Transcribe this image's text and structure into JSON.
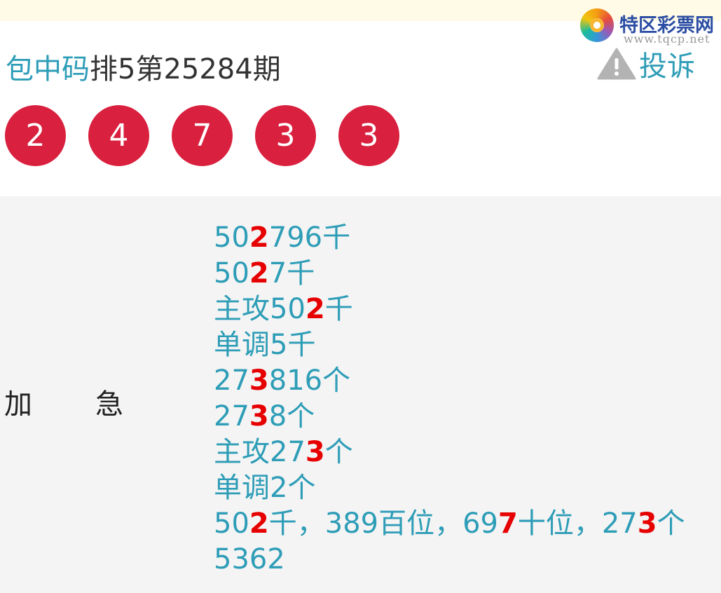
{
  "logo": {
    "name": "特区彩票网",
    "url": "www.tqcp.net"
  },
  "header": {
    "brand": "包中码",
    "title": "排5第25284期"
  },
  "complain": {
    "label": "投诉"
  },
  "numbers": [
    "2",
    "4",
    "7",
    "3",
    "3"
  ],
  "panel": {
    "tag_left": "加",
    "tag_right": "急",
    "lines": [
      [
        "50",
        "2",
        "796千"
      ],
      [
        "50",
        "2",
        "7千"
      ],
      [
        "主攻50",
        "2",
        "千"
      ],
      [
        "单调5千"
      ],
      [
        "27",
        "3",
        "816个"
      ],
      [
        "27",
        "3",
        "8个"
      ],
      [
        "主攻27",
        "3",
        "个"
      ],
      [
        "单调2个"
      ],
      [
        "50",
        "2",
        "千，389百位，69",
        "7",
        "十位，27",
        "3",
        "个"
      ],
      [
        "5362"
      ]
    ]
  },
  "colors": {
    "accent": "#2e9db7",
    "ball": "#d9203e",
    "hit": "#e60000",
    "panel_bg": "#f4f4f4",
    "topbar": "#fffbe6"
  }
}
